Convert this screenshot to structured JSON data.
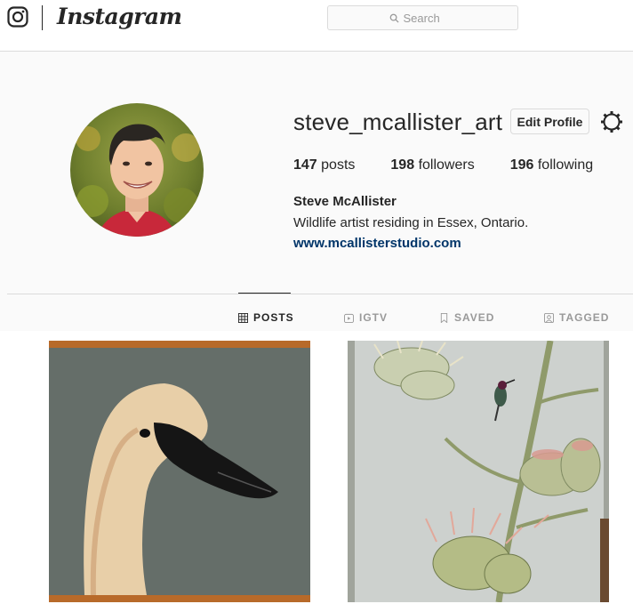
{
  "header": {
    "brand": "Instagram",
    "search_placeholder": "Search"
  },
  "icons": {
    "logo": "instagram-camera-icon",
    "search": "search-icon",
    "settings": "gear-icon"
  },
  "profile": {
    "username": "steve_mcallister_art",
    "edit_label": "Edit Profile",
    "stats": {
      "posts_count": "147",
      "posts_label": "posts",
      "followers_count": "198",
      "followers_label": "followers",
      "following_count": "196",
      "following_label": "following"
    },
    "full_name": "Steve McAllister",
    "bio": "Wildlife artist residing in Essex, Ontario.",
    "website": "www.mcallisterstudio.com"
  },
  "tabs": [
    {
      "label": "POSTS",
      "icon": "grid-icon",
      "active": true
    },
    {
      "label": "IGTV",
      "icon": "igtv-icon",
      "active": false
    },
    {
      "label": "SAVED",
      "icon": "bookmark-icon",
      "active": false
    },
    {
      "label": "TAGGED",
      "icon": "tagged-icon",
      "active": false
    }
  ],
  "colors": {
    "link": "#003569",
    "border": "#dbdbdb",
    "text": "#262626",
    "muted": "#999999"
  }
}
